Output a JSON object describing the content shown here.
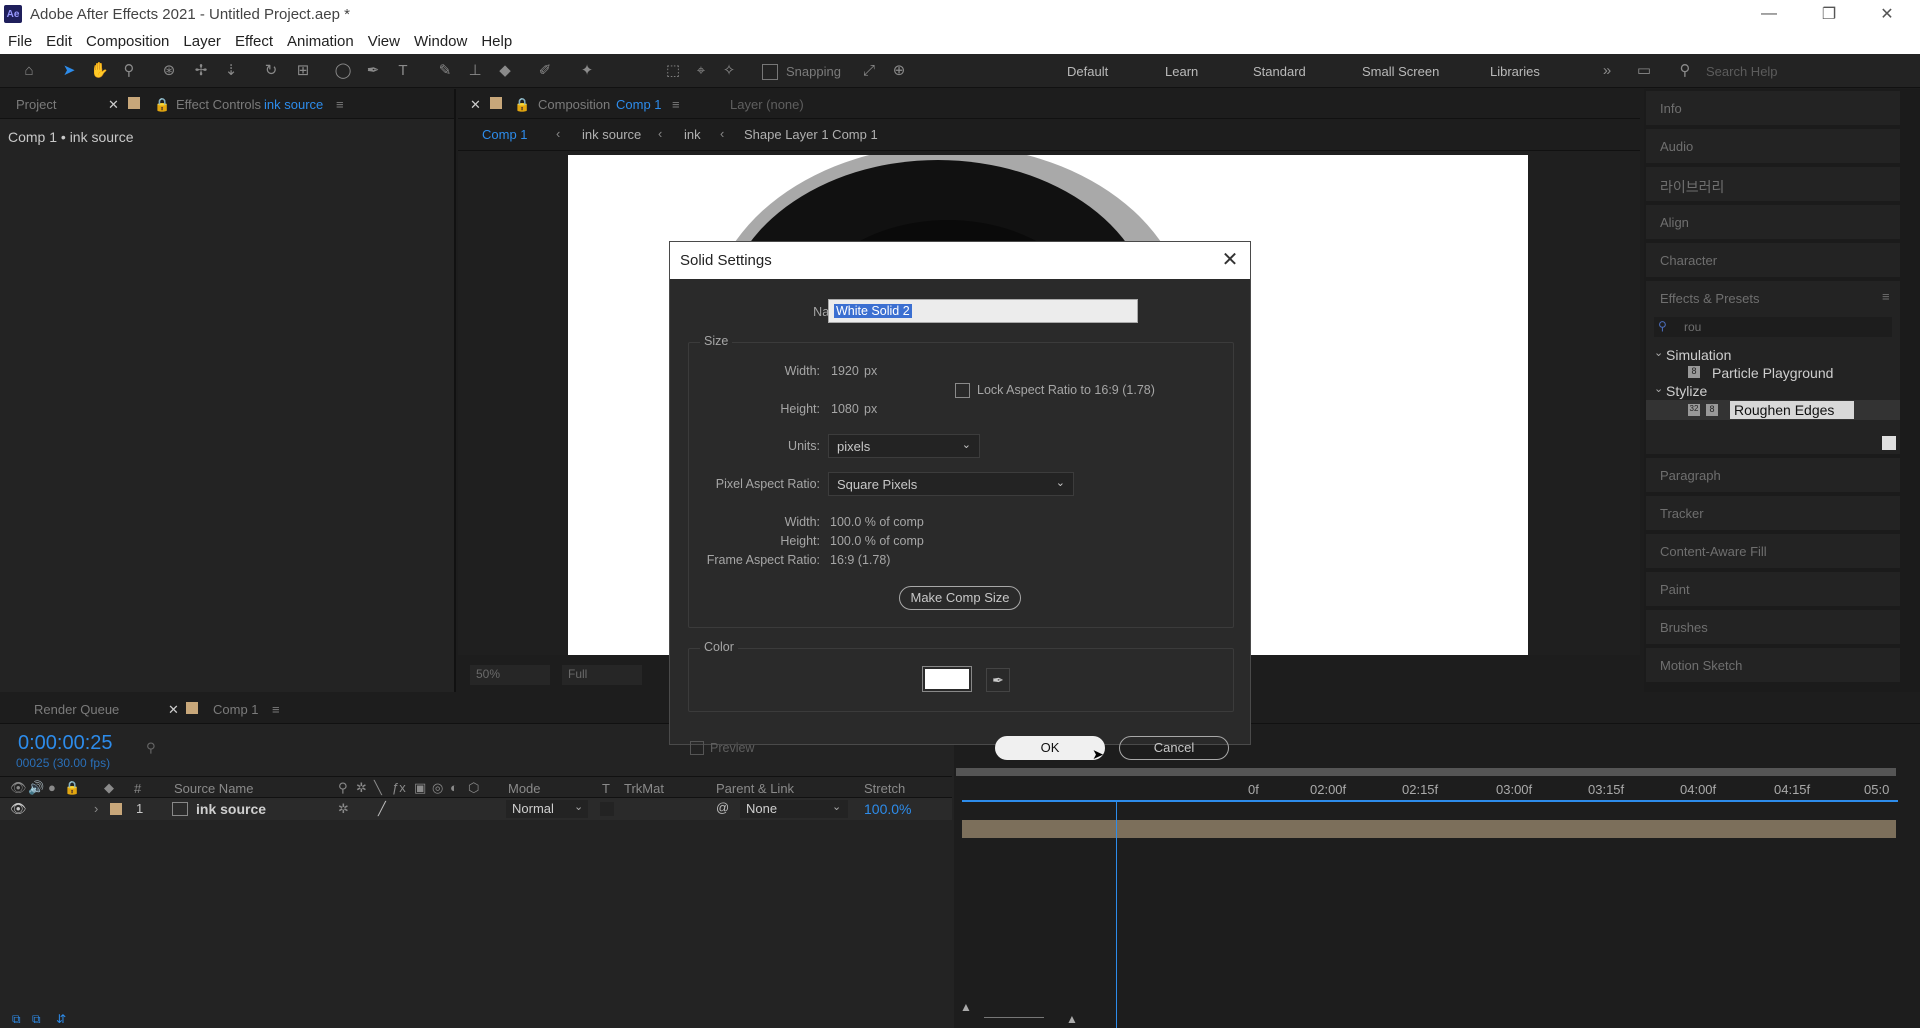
{
  "app": {
    "title": "Adobe After Effects 2021 - Untitled Project.aep *",
    "logo": "Ae"
  },
  "menu": [
    "File",
    "Edit",
    "Composition",
    "Layer",
    "Effect",
    "Animation",
    "View",
    "Window",
    "Help"
  ],
  "toolbar": {
    "snapping": "Snapping",
    "workspaces": [
      "Default",
      "Learn",
      "Standard",
      "Small Screen",
      "Libraries"
    ],
    "search_placeholder": "Search Help"
  },
  "left_panel": {
    "tab_project": "Project",
    "tab_effect_controls": "Effect Controls",
    "effect_controls_target": "ink source",
    "subtitle": "Comp 1 • ink source"
  },
  "comp_panel": {
    "tab_label": "Composition",
    "tab_comp": "Comp 1",
    "layer_tab": "Layer (none)",
    "breadcrumbs": [
      "Comp 1",
      "ink source",
      "ink",
      "Shape Layer 1 Comp 1"
    ],
    "zoom": "50%",
    "resolution": "Full"
  },
  "right_panel": {
    "items": [
      "Info",
      "Audio",
      "라이브러리",
      "Align",
      "Character",
      "Effects & Presets"
    ],
    "search_value": "rou",
    "tree": [
      {
        "group": "Simulation",
        "effect": "Particle Playground"
      },
      {
        "group": "Stylize",
        "effect": "Roughen Edges"
      }
    ],
    "lower_items": [
      "Paragraph",
      "Tracker",
      "Content-Aware Fill",
      "Paint",
      "Brushes",
      "Motion Sketch"
    ]
  },
  "dialog": {
    "title": "Solid Settings",
    "name_label": "Name:",
    "name_value": "White Solid 2",
    "size_legend": "Size",
    "width_label": "Width:",
    "width_value": "1920",
    "width_unit": "px",
    "height_label": "Height:",
    "height_value": "1080",
    "height_unit": "px",
    "lock_label": "Lock Aspect Ratio to 16:9 (1.78)",
    "units_label": "Units:",
    "units_value": "pixels",
    "par_label": "Pixel Aspect Ratio:",
    "par_value": "Square Pixels",
    "pct_width_label": "Width:",
    "pct_width_value": "100.0 % of comp",
    "pct_height_label": "Height:",
    "pct_height_value": "100.0 % of comp",
    "far_label": "Frame Aspect Ratio:",
    "far_value": "16:9 (1.78)",
    "make_comp_size": "Make Comp Size",
    "color_legend": "Color",
    "swatch_color": "#ffffff",
    "preview_label": "Preview",
    "ok": "OK",
    "cancel": "Cancel"
  },
  "timeline": {
    "tab_render_queue": "Render Queue",
    "tab_comp": "Comp 1",
    "timecode": "0:00:00:25",
    "frame_info": "00025 (30.00 fps)",
    "columns": {
      "num": "#",
      "source_name": "Source Name",
      "mode": "Mode",
      "t": "T",
      "trkmat": "TrkMat",
      "parent": "Parent & Link",
      "stretch": "Stretch"
    },
    "layer": {
      "index": "1",
      "name": "ink source",
      "mode": "Normal",
      "parent": "None",
      "stretch": "100.0%"
    },
    "ruler": [
      "0f",
      "02:00f",
      "02:15f",
      "03:00f",
      "03:15f",
      "04:00f",
      "04:15f",
      "05:0"
    ]
  }
}
